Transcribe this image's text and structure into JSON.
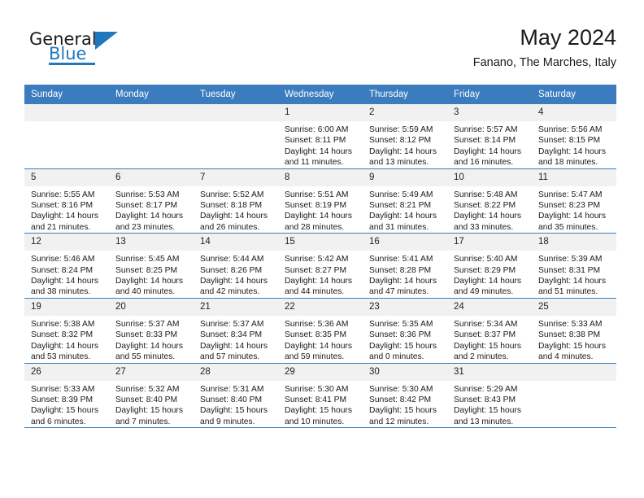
{
  "logo": {
    "word_one": "General",
    "word_two": "Blue",
    "triangle_icon": "triangle-icon",
    "accent_color": "#2077bc"
  },
  "header": {
    "title": "May 2024",
    "subtitle": "Fanano, The Marches, Italy"
  },
  "theme": {
    "header_row_color": "#3a7cbe",
    "daynum_band_color": "#f1f1f1",
    "separator_color": "#3a7cbe",
    "text_color": "#1a1a1a"
  },
  "calendar": {
    "weekday_headers": [
      "Sunday",
      "Monday",
      "Tuesday",
      "Wednesday",
      "Thursday",
      "Friday",
      "Saturday"
    ],
    "weeks": [
      [
        {
          "day": "",
          "empty": true,
          "sunrise": "",
          "sunset": "",
          "daylight_line1": "",
          "daylight_line2": ""
        },
        {
          "day": "",
          "empty": true,
          "sunrise": "",
          "sunset": "",
          "daylight_line1": "",
          "daylight_line2": ""
        },
        {
          "day": "",
          "empty": true,
          "sunrise": "",
          "sunset": "",
          "daylight_line1": "",
          "daylight_line2": ""
        },
        {
          "day": "1",
          "empty": false,
          "sunrise": "Sunrise: 6:00 AM",
          "sunset": "Sunset: 8:11 PM",
          "daylight_line1": "Daylight: 14 hours",
          "daylight_line2": "and 11 minutes."
        },
        {
          "day": "2",
          "empty": false,
          "sunrise": "Sunrise: 5:59 AM",
          "sunset": "Sunset: 8:12 PM",
          "daylight_line1": "Daylight: 14 hours",
          "daylight_line2": "and 13 minutes."
        },
        {
          "day": "3",
          "empty": false,
          "sunrise": "Sunrise: 5:57 AM",
          "sunset": "Sunset: 8:14 PM",
          "daylight_line1": "Daylight: 14 hours",
          "daylight_line2": "and 16 minutes."
        },
        {
          "day": "4",
          "empty": false,
          "sunrise": "Sunrise: 5:56 AM",
          "sunset": "Sunset: 8:15 PM",
          "daylight_line1": "Daylight: 14 hours",
          "daylight_line2": "and 18 minutes."
        }
      ],
      [
        {
          "day": "5",
          "empty": false,
          "sunrise": "Sunrise: 5:55 AM",
          "sunset": "Sunset: 8:16 PM",
          "daylight_line1": "Daylight: 14 hours",
          "daylight_line2": "and 21 minutes."
        },
        {
          "day": "6",
          "empty": false,
          "sunrise": "Sunrise: 5:53 AM",
          "sunset": "Sunset: 8:17 PM",
          "daylight_line1": "Daylight: 14 hours",
          "daylight_line2": "and 23 minutes."
        },
        {
          "day": "7",
          "empty": false,
          "sunrise": "Sunrise: 5:52 AM",
          "sunset": "Sunset: 8:18 PM",
          "daylight_line1": "Daylight: 14 hours",
          "daylight_line2": "and 26 minutes."
        },
        {
          "day": "8",
          "empty": false,
          "sunrise": "Sunrise: 5:51 AM",
          "sunset": "Sunset: 8:19 PM",
          "daylight_line1": "Daylight: 14 hours",
          "daylight_line2": "and 28 minutes."
        },
        {
          "day": "9",
          "empty": false,
          "sunrise": "Sunrise: 5:49 AM",
          "sunset": "Sunset: 8:21 PM",
          "daylight_line1": "Daylight: 14 hours",
          "daylight_line2": "and 31 minutes."
        },
        {
          "day": "10",
          "empty": false,
          "sunrise": "Sunrise: 5:48 AM",
          "sunset": "Sunset: 8:22 PM",
          "daylight_line1": "Daylight: 14 hours",
          "daylight_line2": "and 33 minutes."
        },
        {
          "day": "11",
          "empty": false,
          "sunrise": "Sunrise: 5:47 AM",
          "sunset": "Sunset: 8:23 PM",
          "daylight_line1": "Daylight: 14 hours",
          "daylight_line2": "and 35 minutes."
        }
      ],
      [
        {
          "day": "12",
          "empty": false,
          "sunrise": "Sunrise: 5:46 AM",
          "sunset": "Sunset: 8:24 PM",
          "daylight_line1": "Daylight: 14 hours",
          "daylight_line2": "and 38 minutes."
        },
        {
          "day": "13",
          "empty": false,
          "sunrise": "Sunrise: 5:45 AM",
          "sunset": "Sunset: 8:25 PM",
          "daylight_line1": "Daylight: 14 hours",
          "daylight_line2": "and 40 minutes."
        },
        {
          "day": "14",
          "empty": false,
          "sunrise": "Sunrise: 5:44 AM",
          "sunset": "Sunset: 8:26 PM",
          "daylight_line1": "Daylight: 14 hours",
          "daylight_line2": "and 42 minutes."
        },
        {
          "day": "15",
          "empty": false,
          "sunrise": "Sunrise: 5:42 AM",
          "sunset": "Sunset: 8:27 PM",
          "daylight_line1": "Daylight: 14 hours",
          "daylight_line2": "and 44 minutes."
        },
        {
          "day": "16",
          "empty": false,
          "sunrise": "Sunrise: 5:41 AM",
          "sunset": "Sunset: 8:28 PM",
          "daylight_line1": "Daylight: 14 hours",
          "daylight_line2": "and 47 minutes."
        },
        {
          "day": "17",
          "empty": false,
          "sunrise": "Sunrise: 5:40 AM",
          "sunset": "Sunset: 8:29 PM",
          "daylight_line1": "Daylight: 14 hours",
          "daylight_line2": "and 49 minutes."
        },
        {
          "day": "18",
          "empty": false,
          "sunrise": "Sunrise: 5:39 AM",
          "sunset": "Sunset: 8:31 PM",
          "daylight_line1": "Daylight: 14 hours",
          "daylight_line2": "and 51 minutes."
        }
      ],
      [
        {
          "day": "19",
          "empty": false,
          "sunrise": "Sunrise: 5:38 AM",
          "sunset": "Sunset: 8:32 PM",
          "daylight_line1": "Daylight: 14 hours",
          "daylight_line2": "and 53 minutes."
        },
        {
          "day": "20",
          "empty": false,
          "sunrise": "Sunrise: 5:37 AM",
          "sunset": "Sunset: 8:33 PM",
          "daylight_line1": "Daylight: 14 hours",
          "daylight_line2": "and 55 minutes."
        },
        {
          "day": "21",
          "empty": false,
          "sunrise": "Sunrise: 5:37 AM",
          "sunset": "Sunset: 8:34 PM",
          "daylight_line1": "Daylight: 14 hours",
          "daylight_line2": "and 57 minutes."
        },
        {
          "day": "22",
          "empty": false,
          "sunrise": "Sunrise: 5:36 AM",
          "sunset": "Sunset: 8:35 PM",
          "daylight_line1": "Daylight: 14 hours",
          "daylight_line2": "and 59 minutes."
        },
        {
          "day": "23",
          "empty": false,
          "sunrise": "Sunrise: 5:35 AM",
          "sunset": "Sunset: 8:36 PM",
          "daylight_line1": "Daylight: 15 hours",
          "daylight_line2": "and 0 minutes."
        },
        {
          "day": "24",
          "empty": false,
          "sunrise": "Sunrise: 5:34 AM",
          "sunset": "Sunset: 8:37 PM",
          "daylight_line1": "Daylight: 15 hours",
          "daylight_line2": "and 2 minutes."
        },
        {
          "day": "25",
          "empty": false,
          "sunrise": "Sunrise: 5:33 AM",
          "sunset": "Sunset: 8:38 PM",
          "daylight_line1": "Daylight: 15 hours",
          "daylight_line2": "and 4 minutes."
        }
      ],
      [
        {
          "day": "26",
          "empty": false,
          "sunrise": "Sunrise: 5:33 AM",
          "sunset": "Sunset: 8:39 PM",
          "daylight_line1": "Daylight: 15 hours",
          "daylight_line2": "and 6 minutes."
        },
        {
          "day": "27",
          "empty": false,
          "sunrise": "Sunrise: 5:32 AM",
          "sunset": "Sunset: 8:40 PM",
          "daylight_line1": "Daylight: 15 hours",
          "daylight_line2": "and 7 minutes."
        },
        {
          "day": "28",
          "empty": false,
          "sunrise": "Sunrise: 5:31 AM",
          "sunset": "Sunset: 8:40 PM",
          "daylight_line1": "Daylight: 15 hours",
          "daylight_line2": "and 9 minutes."
        },
        {
          "day": "29",
          "empty": false,
          "sunrise": "Sunrise: 5:30 AM",
          "sunset": "Sunset: 8:41 PM",
          "daylight_line1": "Daylight: 15 hours",
          "daylight_line2": "and 10 minutes."
        },
        {
          "day": "30",
          "empty": false,
          "sunrise": "Sunrise: 5:30 AM",
          "sunset": "Sunset: 8:42 PM",
          "daylight_line1": "Daylight: 15 hours",
          "daylight_line2": "and 12 minutes."
        },
        {
          "day": "31",
          "empty": false,
          "sunrise": "Sunrise: 5:29 AM",
          "sunset": "Sunset: 8:43 PM",
          "daylight_line1": "Daylight: 15 hours",
          "daylight_line2": "and 13 minutes."
        },
        {
          "day": "",
          "empty": true,
          "sunrise": "",
          "sunset": "",
          "daylight_line1": "",
          "daylight_line2": ""
        }
      ]
    ]
  }
}
